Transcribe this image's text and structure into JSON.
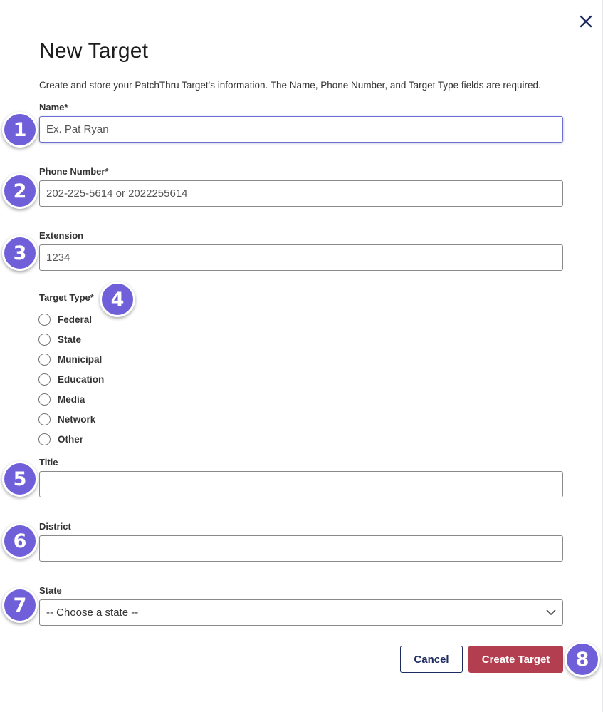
{
  "dialog": {
    "title": "New Target",
    "description": "Create and store your PatchThru Target's information. The Name, Phone Number, and Target Type fields are required."
  },
  "fields": {
    "name": {
      "label": "Name*",
      "placeholder": "Ex. Pat Ryan",
      "value": ""
    },
    "phone": {
      "label": "Phone Number*",
      "placeholder": "202-225-5614 or 2022255614",
      "value": ""
    },
    "extension": {
      "label": "Extension",
      "placeholder": "1234",
      "value": ""
    },
    "target_type": {
      "label": "Target Type*",
      "options": [
        "Federal",
        "State",
        "Municipal",
        "Education",
        "Media",
        "Network",
        "Other"
      ],
      "selected": null
    },
    "title": {
      "label": "Title",
      "placeholder": "",
      "value": ""
    },
    "district": {
      "label": "District",
      "placeholder": "",
      "value": ""
    },
    "state": {
      "label": "State",
      "selected": "-- Choose a state --"
    }
  },
  "buttons": {
    "cancel": "Cancel",
    "create": "Create Target"
  },
  "badges": [
    "1",
    "2",
    "3",
    "4",
    "5",
    "6",
    "7",
    "8"
  ],
  "icons": {
    "close": "close-icon",
    "dropdown": "chevron-down-icon"
  },
  "colors": {
    "badge": "#6f5fd9",
    "primary_button": "#b33e4f",
    "secondary_button_border": "#1e2b5e",
    "focus_border": "#6b6fcf"
  }
}
